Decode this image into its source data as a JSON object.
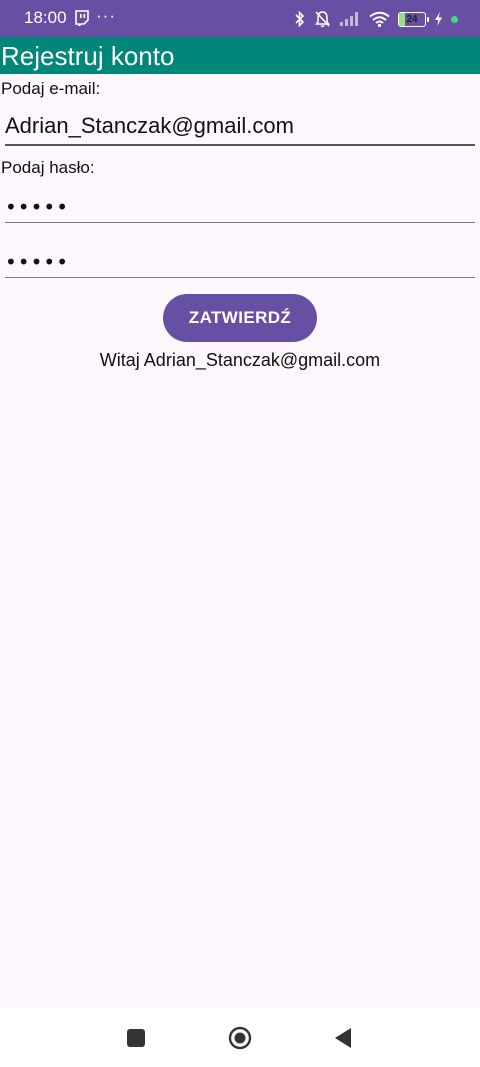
{
  "status_bar": {
    "time": "18:00",
    "more_glyph": "···",
    "battery_level": 24,
    "battery_label": "24",
    "icons": [
      "twitch-icon",
      "bluetooth-icon",
      "bell-muted-icon",
      "signal-icon",
      "wifi-icon",
      "battery-icon",
      "charging-icon",
      "green-dot-icon"
    ]
  },
  "app_bar": {
    "title": "Rejestruj konto",
    "color": "#00877a"
  },
  "form": {
    "email_label": "Podaj e-mail:",
    "email_value": "Adrian_Stanczak@gmail.com",
    "password_label": "Podaj hasło:",
    "password_value": "•••••",
    "password_confirm_value": "•••••",
    "submit_label": "ZATWIERDŹ"
  },
  "welcome_message": "Witaj Adrian_Stanczak@gmail.com",
  "colors": {
    "status_bar": "#6750a4",
    "button": "#6750a4",
    "background": "#fcf7fc"
  }
}
